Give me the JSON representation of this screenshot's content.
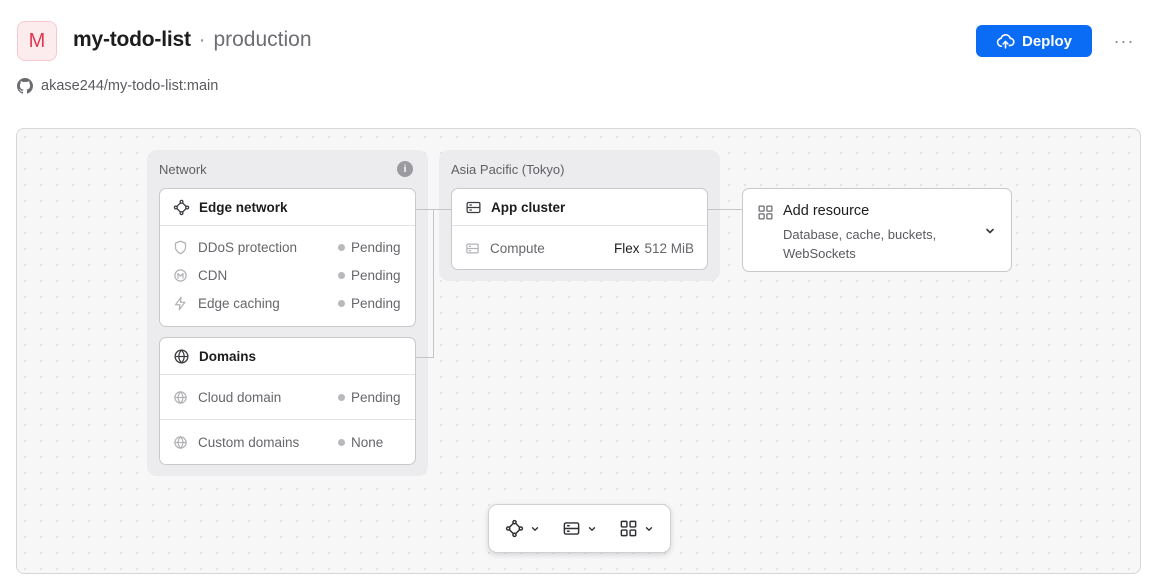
{
  "header": {
    "avatar_letter": "M",
    "app_name": "my-todo-list",
    "separator": "·",
    "environment": "production",
    "repo": "akase244/my-todo-list:main",
    "deploy_label": "Deploy",
    "more_label": "···"
  },
  "network_group": {
    "label": "Network",
    "info_icon": "info-icon",
    "edge_card": {
      "title": "Edge network",
      "rows": [
        {
          "name": "DDoS protection",
          "status": "Pending",
          "icon": "shield-icon"
        },
        {
          "name": "CDN",
          "status": "Pending",
          "icon": "cdn-icon"
        },
        {
          "name": "Edge caching",
          "status": "Pending",
          "icon": "bolt-icon"
        }
      ]
    },
    "domains_card": {
      "title": "Domains",
      "rows": [
        {
          "name": "Cloud domain",
          "status": "Pending",
          "icon": "globe-icon"
        },
        {
          "name": "Custom domains",
          "status": "None",
          "icon": "globe-icon"
        }
      ]
    }
  },
  "region_group": {
    "label": "Asia Pacific (Tokyo)",
    "app_card": {
      "title": "App cluster",
      "compute_label": "Compute",
      "compute_type": "Flex",
      "compute_size": "512 MiB"
    }
  },
  "add_resource": {
    "title": "Add resource",
    "description": "Database, cache, buckets, WebSockets"
  },
  "toolbar": {
    "buttons": [
      "network-icon",
      "server-icon",
      "grid-icon"
    ]
  },
  "colors": {
    "accent": "#0a6cf5",
    "avatar_bg": "#fdecee",
    "avatar_fg": "#e2384d",
    "status_dot": "#b8b8bd"
  }
}
